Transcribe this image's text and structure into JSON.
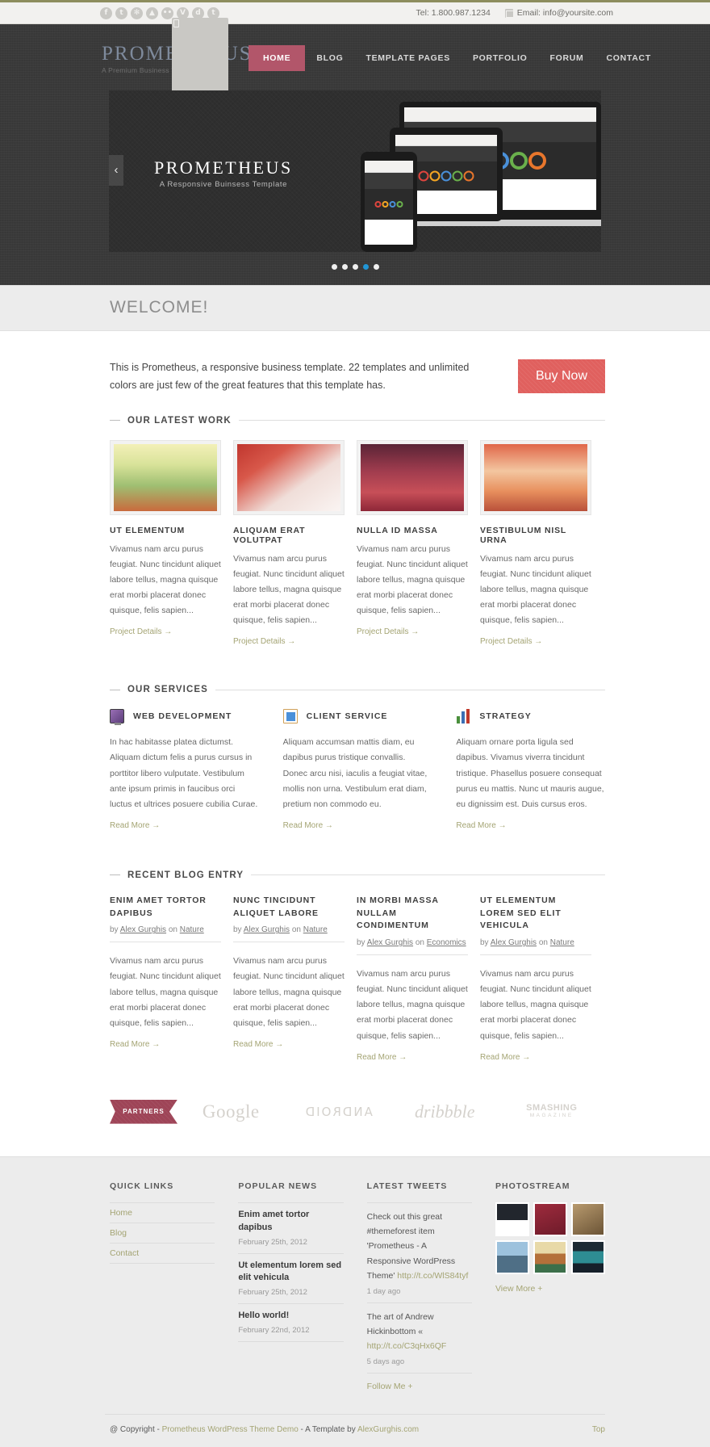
{
  "topbar": {
    "social": [
      {
        "name": "facebook-icon",
        "glyph": "f"
      },
      {
        "name": "twitter-icon",
        "glyph": "t"
      },
      {
        "name": "dribbble-icon",
        "glyph": "✻"
      },
      {
        "name": "delicious-icon",
        "glyph": "▲"
      },
      {
        "name": "flickr-icon",
        "glyph": "••"
      },
      {
        "name": "vimeo-icon",
        "glyph": "V"
      },
      {
        "name": "digg-icon",
        "glyph": "d"
      },
      {
        "name": "tumblr-icon",
        "glyph": "t"
      }
    ],
    "phone": "Tel: 1.800.987.1234",
    "email": "Email: info@yoursite.com"
  },
  "header": {
    "logo_title": "PROMETHEUS",
    "logo_sub": "A Premium Business Template",
    "nav": [
      {
        "label": "HOME",
        "active": true
      },
      {
        "label": "BLOG",
        "active": false
      },
      {
        "label": "TEMPLATE PAGES",
        "active": false
      },
      {
        "label": "PORTFOLIO",
        "active": false
      },
      {
        "label": "FORUM",
        "active": false
      },
      {
        "label": "CONTACT",
        "active": false
      }
    ]
  },
  "slider": {
    "title": "PROMETHEUS",
    "subtitle": "A Responsive Buinsess Template",
    "prev_arrow": "‹",
    "next_arrow": "›",
    "dots_count": 5,
    "active_dot": 4
  },
  "welcome": {
    "heading": "WELCOME!",
    "intro": "This is Prometheus, a responsive business template. 22 templates and unlimited colors are just few of the great features that this template has.",
    "buy_label": "Buy Now"
  },
  "latest_work": {
    "heading": "OUR LATEST WORK",
    "items": [
      {
        "title": "UT ELEMENTUM",
        "text": "Vivamus nam arcu purus feugiat. Nunc tincidunt aliquet labore tellus, magna quisque erat morbi placerat donec quisque, felis sapien...",
        "link": "Project Details →"
      },
      {
        "title": "ALIQUAM ERAT VOLUTPAT",
        "text": "Vivamus nam arcu purus feugiat. Nunc tincidunt aliquet labore tellus, magna quisque erat morbi placerat donec quisque, felis sapien...",
        "link": "Project Details →"
      },
      {
        "title": "NULLA ID MASSA",
        "text": "Vivamus nam arcu purus feugiat. Nunc tincidunt aliquet labore tellus, magna quisque erat morbi placerat donec quisque, felis sapien...",
        "link": "Project Details →"
      },
      {
        "title": "VESTIBULUM NISL URNA",
        "text": "Vivamus nam arcu purus feugiat. Nunc tincidunt aliquet labore tellus, magna quisque erat morbi placerat donec quisque, felis sapien...",
        "link": "Project Details →"
      }
    ]
  },
  "services": {
    "heading": "OUR SERVICES",
    "items": [
      {
        "icon": "monitor-icon",
        "title": "WEB DEVELOPMENT",
        "text": "In hac habitasse platea dictumst. Aliquam dictum felis a purus cursus in porttitor libero vulputate. Vestibulum ante ipsum primis in faucibus orci luctus et ultrices posuere cubilia Curae.",
        "link": "Read More →"
      },
      {
        "icon": "document-icon",
        "title": "CLIENT SERVICE",
        "text": "Aliquam accumsan mattis diam, eu dapibus purus tristique convallis. Donec arcu nisi, iaculis a feugiat vitae, mollis non urna. Vestibulum erat diam, pretium non commodo eu.",
        "link": "Read More →"
      },
      {
        "icon": "bar-chart-icon",
        "title": "STRATEGY",
        "text": "Aliquam ornare porta ligula sed dapibus. Vivamus viverra tincidunt tristique. Phasellus posuere consequat purus eu mattis. Nunc ut mauris augue, eu dignissim est. Duis cursus eros.",
        "link": "Read More →"
      }
    ]
  },
  "blog": {
    "heading": "RECENT BLOG ENTRY",
    "items": [
      {
        "title": "ENIM AMET TORTOR DAPIBUS",
        "by": "by",
        "author": "Alex Gurghis",
        "on": "on",
        "category": "Nature",
        "text": "Vivamus nam arcu purus feugiat. Nunc tincidunt aliquet labore tellus, magna quisque erat morbi placerat donec quisque, felis sapien...",
        "link": "Read More →"
      },
      {
        "title": "NUNC TINCIDUNT ALIQUET LABORE",
        "by": "by",
        "author": "Alex Gurghis",
        "on": "on",
        "category": "Nature",
        "text": "Vivamus nam arcu purus feugiat. Nunc tincidunt aliquet labore tellus, magna quisque erat morbi placerat donec quisque, felis sapien...",
        "link": "Read More →"
      },
      {
        "title": "IN MORBI MASSA NULLAM CONDIMENTUM",
        "by": "by",
        "author": "Alex Gurghis",
        "on": "on",
        "category": "Economics",
        "text": "Vivamus nam arcu purus feugiat. Nunc tincidunt aliquet labore tellus, magna quisque erat morbi placerat donec quisque, felis sapien...",
        "link": "Read More →"
      },
      {
        "title": "UT ELEMENTUM LOREM SED ELIT VEHICULA",
        "by": "by",
        "author": "Alex Gurghis",
        "on": "on",
        "category": "Nature",
        "text": "Vivamus nam arcu purus feugiat. Nunc tincidunt aliquet labore tellus, magna quisque erat morbi placerat donec quisque, felis sapien...",
        "link": "Read More →"
      }
    ]
  },
  "partners": {
    "ribbon_label": "PARTNERS",
    "logos": [
      {
        "name": "google-logo",
        "label": "Google"
      },
      {
        "name": "android-logo",
        "label": "ANDROID"
      },
      {
        "name": "dribbble-logo",
        "label": "dribbble"
      },
      {
        "name": "smashing-magazine-logo",
        "label": "SMASHING",
        "sub": "MAGAZINE"
      }
    ]
  },
  "footer": {
    "quick_links": {
      "heading": "QUICK LINKS",
      "items": [
        "Home",
        "Blog",
        "Contact"
      ]
    },
    "popular_news": {
      "heading": "POPULAR NEWS",
      "items": [
        {
          "title": "Enim amet tortor dapibus",
          "date": "February 25th, 2012"
        },
        {
          "title": "Ut elementum lorem sed elit vehicula",
          "date": "February 25th, 2012"
        },
        {
          "title": "Hello world!",
          "date": "February 22nd, 2012"
        }
      ]
    },
    "latest_tweets": {
      "heading": "LATEST TWEETS",
      "items": [
        {
          "text": "Check out this great #themeforest item 'Prometheus - A Responsive WordPress Theme'",
          "link": "http://t.co/WlS84tyf",
          "age": "1 day ago"
        },
        {
          "text": "The art of Andrew Hickinbottom «",
          "link": "http://t.co/C3qHx6QF",
          "age": "5 days ago"
        }
      ],
      "follow": "Follow Me +"
    },
    "photostream": {
      "heading": "PHOTOSTREAM",
      "photos": [
        "photo-1",
        "photo-2",
        "photo-3",
        "photo-4",
        "photo-5",
        "photo-6"
      ],
      "view_more": "View More +"
    },
    "copyright_prefix": "@ Copyright - ",
    "copyright_site": "Prometheus WordPress Theme Demo",
    "copyright_mid": " - A Template by ",
    "copyright_author": "AlexGurghis.com",
    "top_label": "Top"
  },
  "colors": {
    "accent_red": "#b2566a",
    "buy_red": "#e0605e",
    "olive_link": "#a4a473",
    "header_dark": "#3a3a3a",
    "band_gray": "#ececec"
  }
}
